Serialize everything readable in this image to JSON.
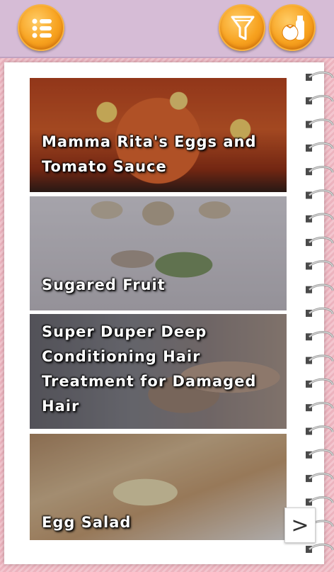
{
  "toolbar": {
    "menu_icon": "list-menu-icon",
    "filter_icon": "funnel-filter-icon",
    "pantry_icon": "tomato-bottle-icon",
    "accent": "#f7a21f",
    "bar_color": "#d6bcd6"
  },
  "recipes": [
    {
      "title": "Mamma Rita's Eggs and Tomato Sauce"
    },
    {
      "title": "Sugared Fruit"
    },
    {
      "title": "Super Duper Deep Conditioning Hair Treatment for Damaged Hair"
    },
    {
      "title": "Egg Salad"
    }
  ],
  "pager": {
    "next_label": ">"
  }
}
